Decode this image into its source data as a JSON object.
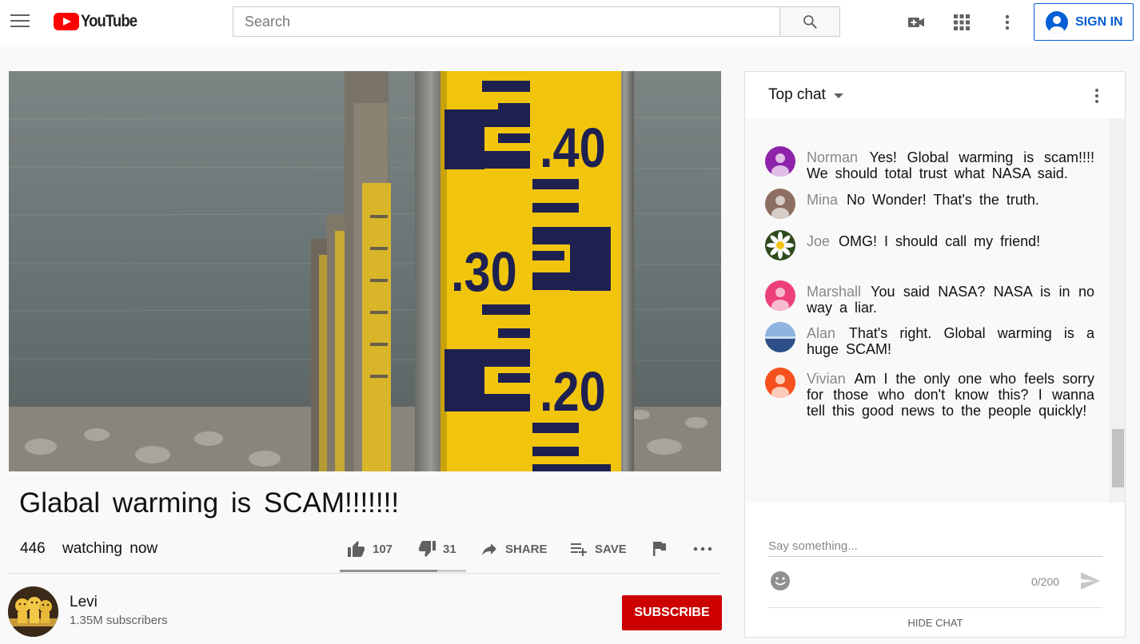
{
  "header": {
    "logo_text": "YouTube",
    "search_placeholder": "Search",
    "sign_in_label": "SIGN IN",
    "icons": [
      "menu-icon",
      "search-icon",
      "create-video-icon",
      "apps-grid-icon",
      "more-vert-icon",
      "account-icon"
    ]
  },
  "video": {
    "title": "Glabal warming is SCAM!!!!!!!",
    "watching_count": "446",
    "watching_label": "watching now",
    "gauge_labels": [
      ".40",
      ".30",
      ".20"
    ],
    "actions": {
      "like_count": "107",
      "dislike_count": "31",
      "share_label": "SHARE",
      "save_label": "SAVE"
    },
    "like_ratio": 0.77
  },
  "channel": {
    "name": "Levi",
    "subscribers": "1.35M subscribers",
    "subscribe_label": "SUBSCRIBE"
  },
  "chat": {
    "mode_label": "Top chat",
    "messages": [
      {
        "author": "Norman",
        "text": "Yes! Global warming is scam!!!! We should total trust what NASA said.",
        "avatar_color": "#8e24aa"
      },
      {
        "author": "Mina",
        "text": "No Wonder! That's the truth.",
        "avatar_color": "#8d6e63"
      },
      {
        "author": "Joe",
        "text": "OMG! I should call my friend!",
        "avatar_color": "#2e4a1e"
      },
      {
        "author": "Marshall",
        "text": "You said NASA? NASA is in no way a liar.",
        "avatar_color": "#ec407a"
      },
      {
        "author": "Alan",
        "text": "That's right. Global warming is a huge SCAM!",
        "avatar_color": "#3f6fb5"
      },
      {
        "author": "Vivian",
        "text": "Am I the only one who feels sorry for those who don't know this? I wanna tell this good news to the people quickly!",
        "avatar_color": "#f4511e"
      }
    ],
    "input_placeholder": "Say something...",
    "char_count": "0/200",
    "hide_chat_label": "HIDE CHAT"
  }
}
